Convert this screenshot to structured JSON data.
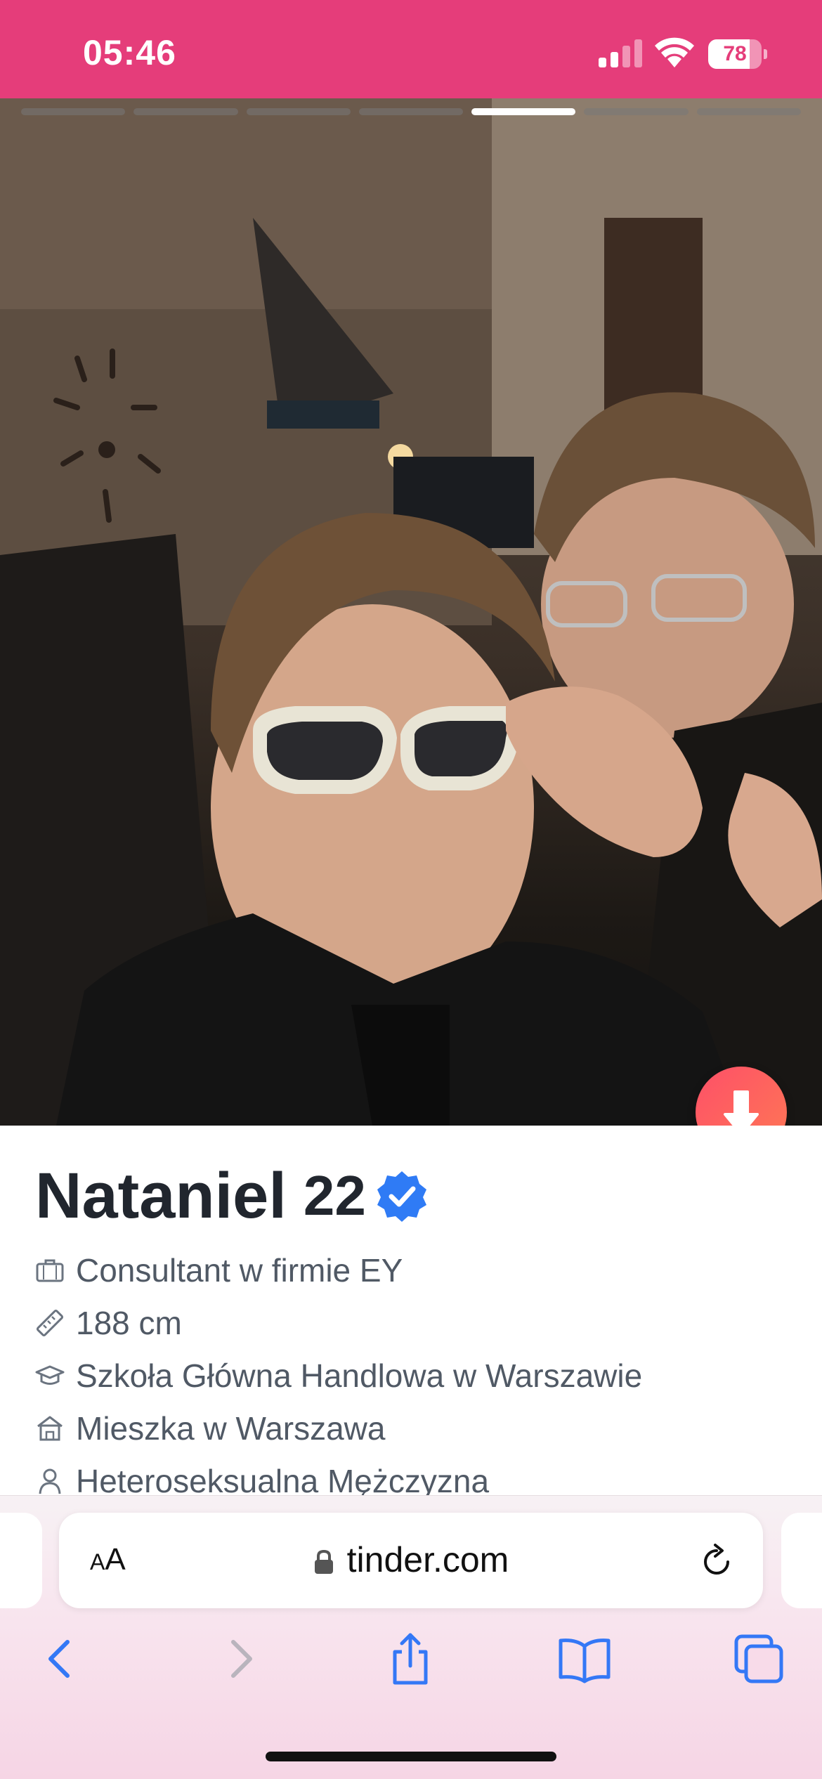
{
  "status_bar": {
    "time": "05:46",
    "battery_level": "78",
    "battery_fraction": 0.78,
    "background_color": "#e53d7a"
  },
  "photo": {
    "total_photos": 7,
    "active_index": 4,
    "description_icons": [
      "chevron-down-icon"
    ]
  },
  "profile": {
    "name": "Nataniel",
    "age": "22",
    "verified": true,
    "details": [
      {
        "icon": "briefcase-icon",
        "text": "Consultant w firmie EY"
      },
      {
        "icon": "ruler-icon",
        "text": "188 cm"
      },
      {
        "icon": "graduation-cap-icon",
        "text": "Szkoła Główna Handlowa w Warszawie"
      },
      {
        "icon": "home-icon",
        "text": "Mieszka w Warszawa"
      },
      {
        "icon": "person-icon",
        "text": "Heteroseksualna Mężczyzna"
      }
    ]
  },
  "browser": {
    "text_size_label_small": "A",
    "text_size_label_large": "A",
    "url": "tinder.com",
    "accent_color": "#3478f6"
  }
}
